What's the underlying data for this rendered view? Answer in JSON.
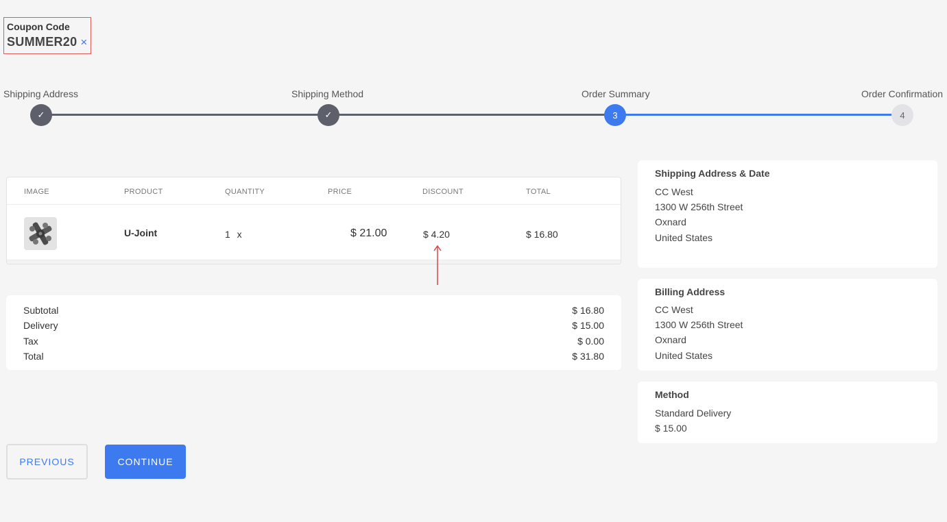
{
  "coupon": {
    "label": "Coupon Code",
    "code": "SUMMER20",
    "remove_icon": "×"
  },
  "steps": [
    {
      "label": "Shipping Address",
      "marker": "✓",
      "status": "done"
    },
    {
      "label": "Shipping Method",
      "marker": "✓",
      "status": "done"
    },
    {
      "label": "Order Summary",
      "marker": "3",
      "status": "active"
    },
    {
      "label": "Order Confirmation",
      "marker": "4",
      "status": "pending"
    }
  ],
  "table": {
    "headers": [
      "IMAGE",
      "PRODUCT",
      "QUANTITY",
      "PRICE",
      "DISCOUNT",
      "TOTAL"
    ],
    "row": {
      "image_icon": "u-joint-part-image",
      "product": "U-Joint",
      "quantity": "1 x",
      "price": "$ 21.00",
      "discount": "$ 4.20",
      "total": "$ 16.80"
    }
  },
  "totals": [
    {
      "label": "Subtotal",
      "value": "$ 16.80"
    },
    {
      "label": "Delivery",
      "value": "$ 15.00"
    },
    {
      "label": "Tax",
      "value": "$ 0.00"
    },
    {
      "label": "Total",
      "value": "$ 31.80"
    }
  ],
  "shipping_card": {
    "title": "Shipping Address & Date",
    "lines": [
      "CC West",
      "1300 W 256th Street",
      "Oxnard",
      "United States"
    ]
  },
  "billing_card": {
    "title": "Billing Address",
    "lines": [
      "CC West",
      "1300 W 256th Street",
      "Oxnard",
      "United States"
    ]
  },
  "method_card": {
    "title": "Method",
    "lines": [
      "Standard Delivery",
      "$ 15.00"
    ]
  },
  "buttons": {
    "previous": "PREVIOUS",
    "continue": "CONTINUE"
  },
  "colors": {
    "accent": "#3d7af0",
    "done_step": "#5d5f6b",
    "pending_step": "#e3e3e7",
    "annotation": "#e05a5a",
    "background": "#f5f5f5"
  }
}
